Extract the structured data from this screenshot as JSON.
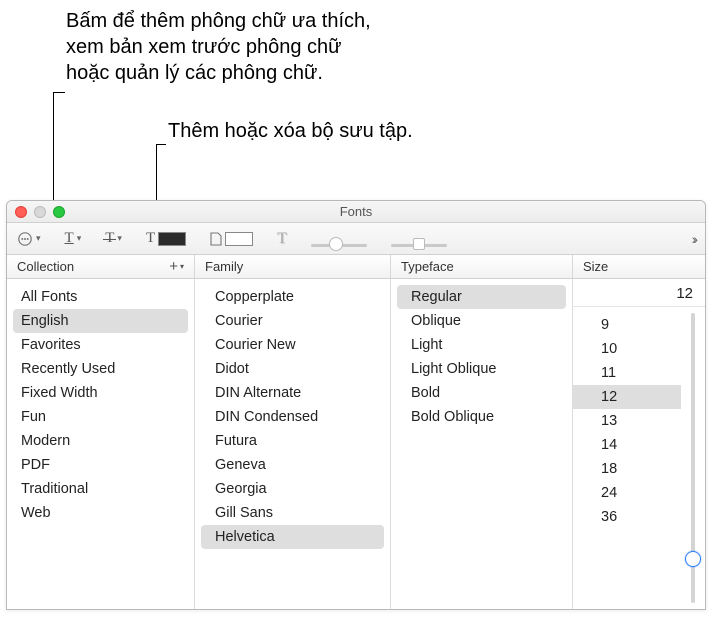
{
  "callouts": {
    "c1_line1": "Bấm để thêm phông chữ ưa thích,",
    "c1_line2": "xem bản xem trước phông chữ",
    "c1_line3": "hoặc quản lý các phông chữ.",
    "c2": "Thêm hoặc xóa bộ sưu tập."
  },
  "window": {
    "title": "Fonts"
  },
  "headers": {
    "collection": "Collection",
    "family": "Family",
    "typeface": "Typeface",
    "size": "Size"
  },
  "collections": [
    "All Fonts",
    "English",
    "Favorites",
    "Recently Used",
    "Fixed Width",
    "Fun",
    "Modern",
    "PDF",
    "Traditional",
    "Web"
  ],
  "collections_selected": "English",
  "families": [
    "Copperplate",
    "Courier",
    "Courier New",
    "Didot",
    "DIN Alternate",
    "DIN Condensed",
    "Futura",
    "Geneva",
    "Georgia",
    "Gill Sans",
    "Helvetica"
  ],
  "families_selected": "Helvetica",
  "typefaces": [
    "Regular",
    "Oblique",
    "Light",
    "Light Oblique",
    "Bold",
    "Bold Oblique"
  ],
  "typefaces_selected": "Regular",
  "size_current": "12",
  "sizes": [
    "9",
    "10",
    "11",
    "12",
    "13",
    "14",
    "18",
    "24",
    "36"
  ],
  "sizes_selected": "12"
}
